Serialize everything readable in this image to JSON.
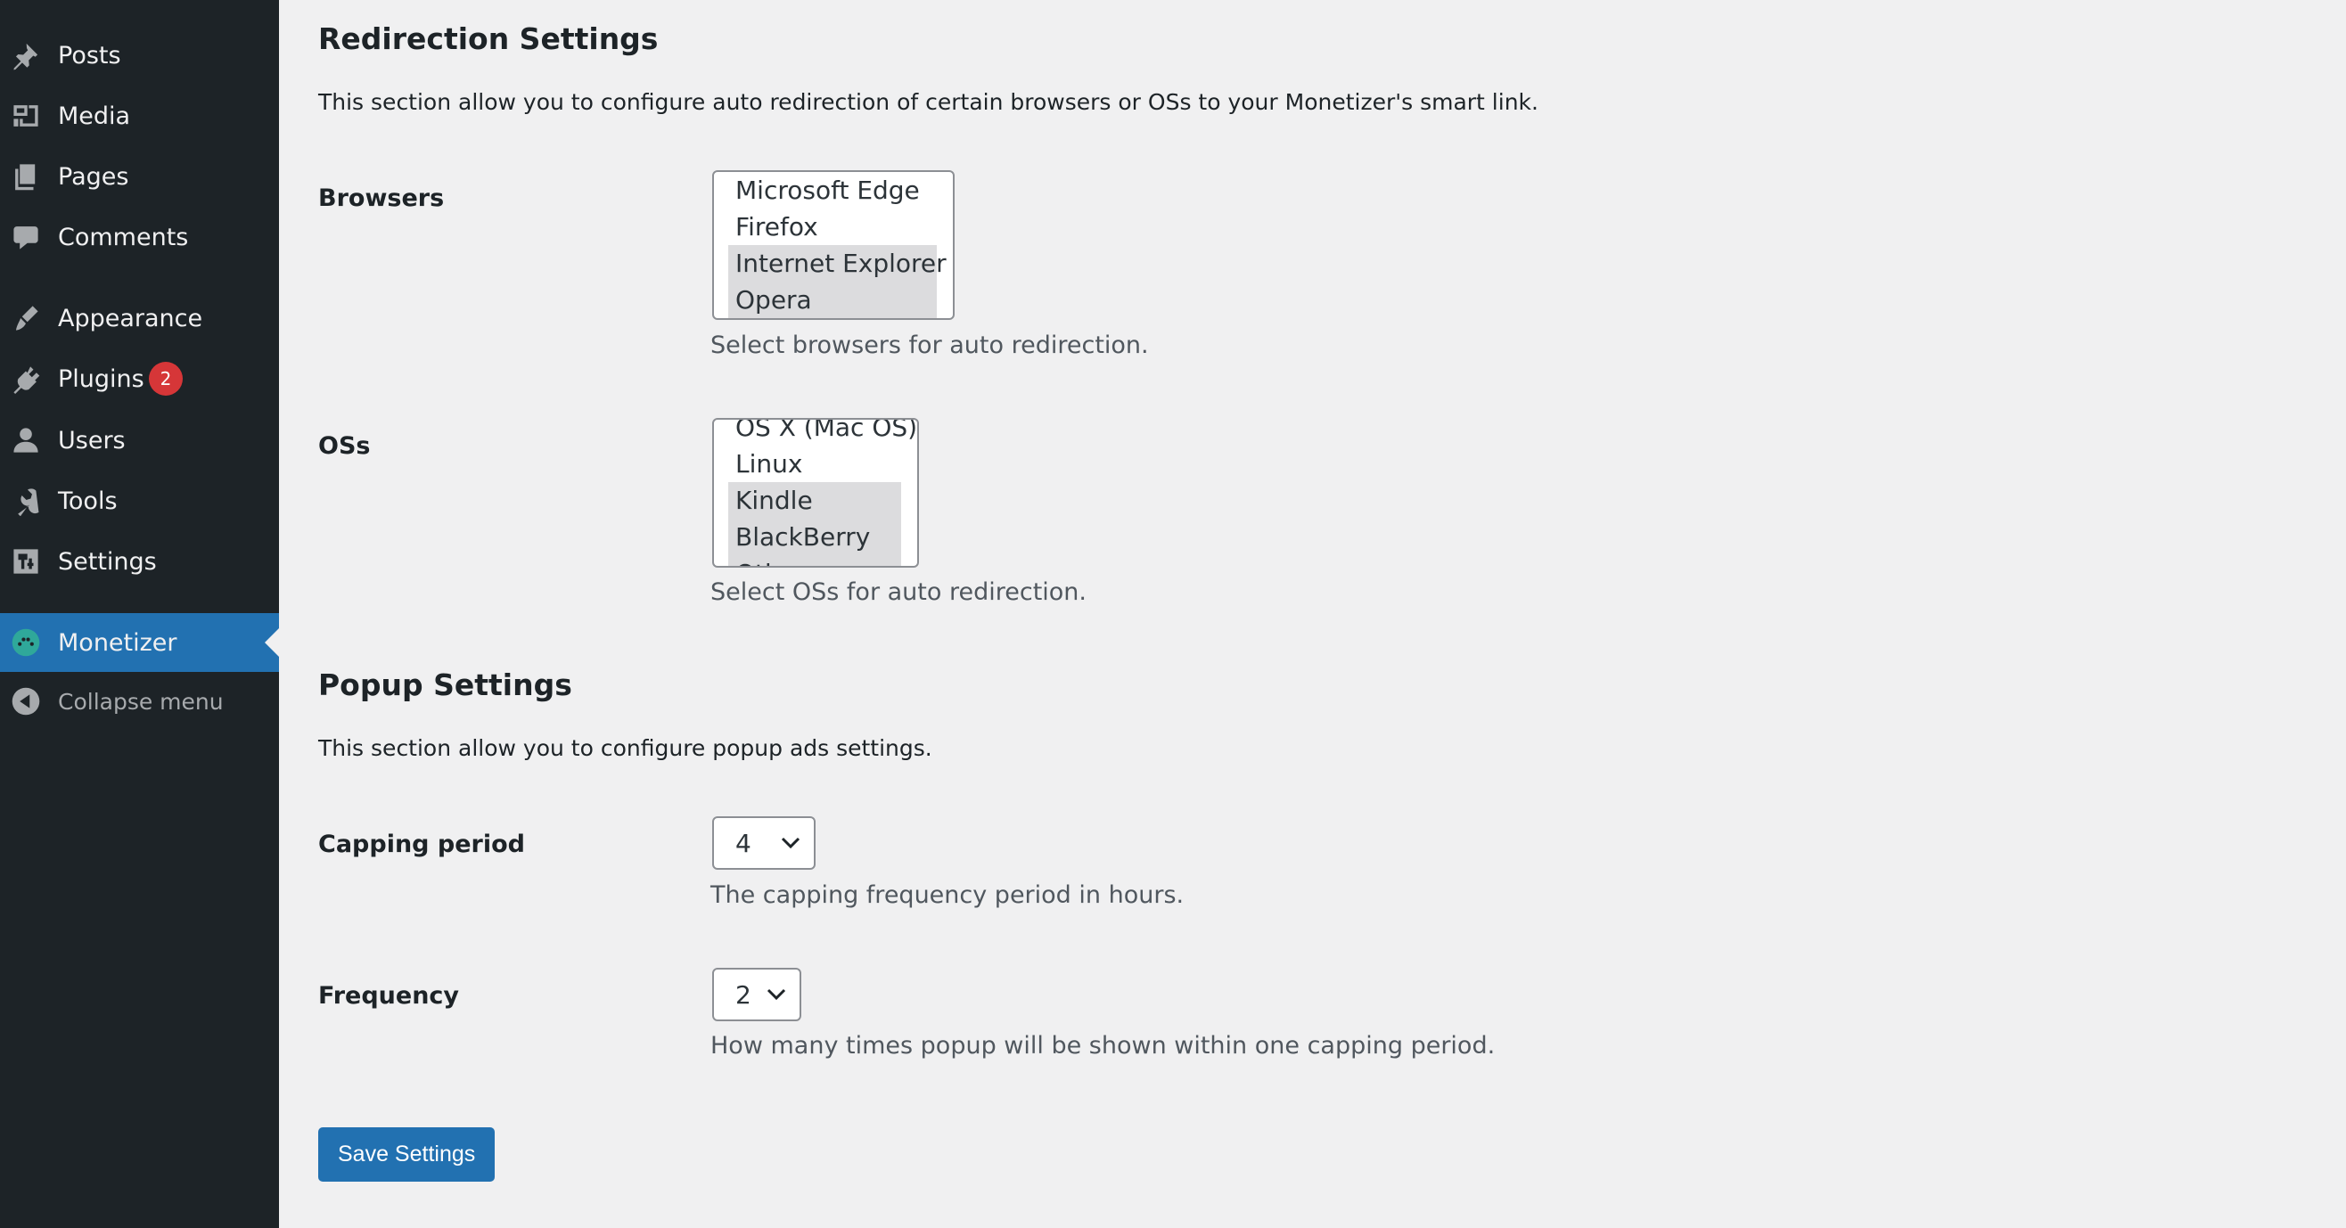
{
  "sidebar": {
    "items": [
      {
        "label": "Posts",
        "icon": "pin-icon"
      },
      {
        "label": "Media",
        "icon": "media-icon"
      },
      {
        "label": "Pages",
        "icon": "pages-icon"
      },
      {
        "label": "Comments",
        "icon": "comment-icon"
      },
      {
        "label": "Appearance",
        "icon": "brush-icon"
      },
      {
        "label": "Plugins",
        "icon": "plugin-icon",
        "badge": "2"
      },
      {
        "label": "Users",
        "icon": "user-icon"
      },
      {
        "label": "Tools",
        "icon": "wrench-icon"
      },
      {
        "label": "Settings",
        "icon": "settings-icon"
      },
      {
        "label": "Monetizer",
        "icon": "monetizer-icon",
        "current": true
      },
      {
        "label": "Collapse menu",
        "icon": "collapse-icon"
      }
    ],
    "accent": "#2271b1",
    "badge_color": "#d63638"
  },
  "redirection": {
    "title": "Redirection Settings",
    "description": "This section allow you to configure auto redirection of certain browsers or OSs to your Monetizer's smart link.",
    "browsers": {
      "label": "Browsers",
      "options": [
        {
          "text": "Microsoft Edge",
          "selected": false
        },
        {
          "text": "Firefox",
          "selected": false
        },
        {
          "text": "Internet Explorer",
          "selected": true
        },
        {
          "text": "Opera",
          "selected": true
        }
      ],
      "help": "Select browsers for auto redirection."
    },
    "oss": {
      "label": "OSs",
      "options": [
        {
          "text": "OS X (Mac OS)",
          "selected": false
        },
        {
          "text": "Linux",
          "selected": false
        },
        {
          "text": "Kindle",
          "selected": true
        },
        {
          "text": "BlackBerry",
          "selected": true
        },
        {
          "text": "Other",
          "selected": true
        }
      ],
      "help": "Select OSs for auto redirection."
    }
  },
  "popup": {
    "title": "Popup Settings",
    "description": "This section allow you to configure popup ads settings.",
    "capping": {
      "label": "Capping period",
      "value": "4",
      "help": "The capping frequency period in hours."
    },
    "frequency": {
      "label": "Frequency",
      "value": "2",
      "help": "How many times popup will be shown within one capping period."
    }
  },
  "save_label": "Save Settings"
}
